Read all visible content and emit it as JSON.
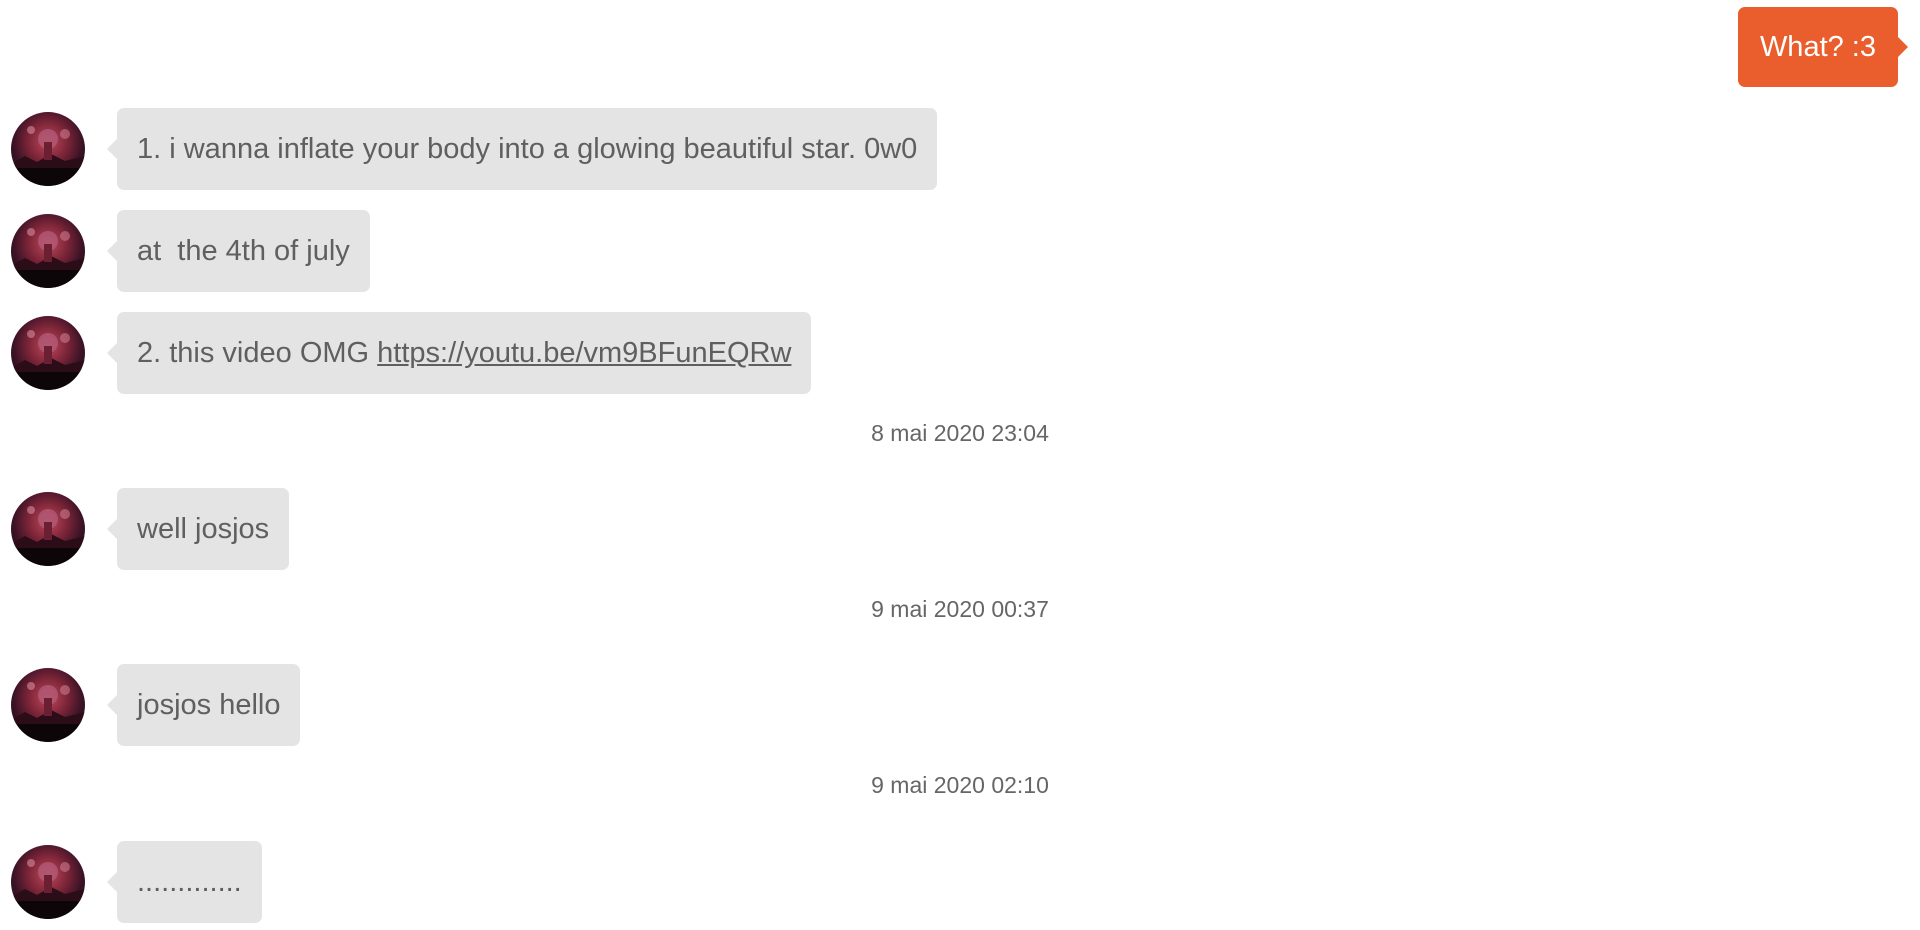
{
  "outgoing": [
    {
      "text": "What? :3"
    }
  ],
  "messages": [
    {
      "text": "1. i wanna inflate your body into a glowing beautiful star. 0w0"
    },
    {
      "text": "at  the 4th of july"
    },
    {
      "text_prefix": "2. this video OMG ",
      "link": "https://youtu.be/vm9BFunEQRw"
    },
    {
      "text": "well josjos"
    },
    {
      "text": "josjos hello"
    },
    {
      "text": "............."
    }
  ],
  "timestamps": [
    "8 mai 2020 23:04",
    "9 mai 2020 00:37",
    "9 mai 2020 02:10"
  ],
  "colors": {
    "outgoing_bubble": "#ea5d2c",
    "incoming_bubble": "#e4e4e4",
    "incoming_text": "#5f5f5f",
    "timestamp_text": "#666666"
  },
  "icons": {
    "avatar": "user-avatar-icon"
  }
}
